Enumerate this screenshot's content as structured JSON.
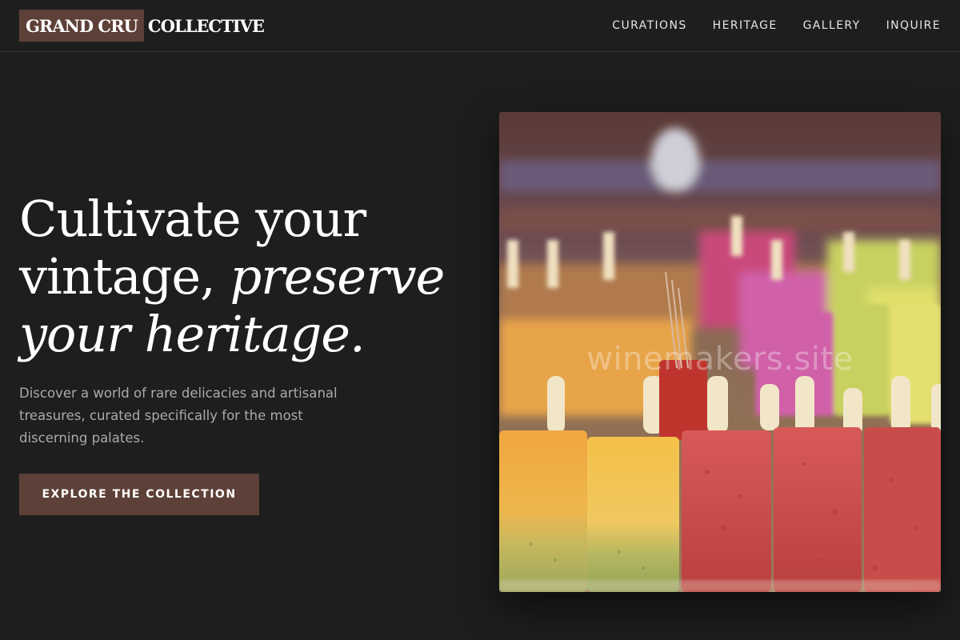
{
  "brand": {
    "highlight": "GRAND CRU",
    "rest": "COLLECTIVE",
    "accent_color": "#5d4037"
  },
  "nav": {
    "items": [
      {
        "label": "CURATIONS"
      },
      {
        "label": "HERITAGE"
      },
      {
        "label": "GALLERY"
      },
      {
        "label": "INQUIRE"
      }
    ]
  },
  "hero": {
    "title_line1": "Cultivate your",
    "title_line2_plain": "vintage, ",
    "title_line2_italic": "preserve",
    "title_line3_italic": "your heritage.",
    "description": "Discover a world of rare delicacies and artisanal treasures, curated specifically for the most discerning palates.",
    "cta_label": "EXPLORE THE COLLECTION",
    "image": {
      "subject": "rows of colorful fruit popsicles on sticks in a display case",
      "watermark": "winemakers.site"
    }
  },
  "colors": {
    "background": "#1e1e1e",
    "text_muted": "#a9aab0"
  }
}
